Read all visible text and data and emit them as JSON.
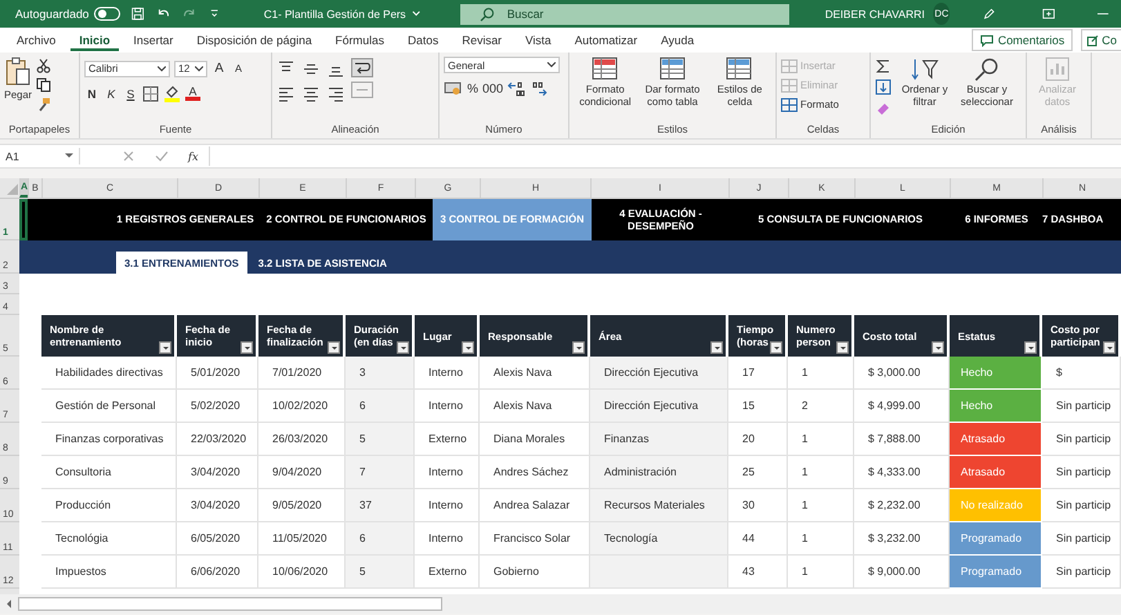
{
  "title_bar": {
    "autosave_label": "Autoguardado",
    "autosave_on": false,
    "file_name": "C1- Plantilla Gestión de Pers",
    "search_placeholder": "Buscar",
    "user_name": "DEIBER CHAVARRI",
    "user_initials": "DC"
  },
  "menu": {
    "tabs": [
      {
        "label": "Archivo",
        "selected": false
      },
      {
        "label": "Inicio",
        "selected": true
      },
      {
        "label": "Insertar",
        "selected": false
      },
      {
        "label": "Disposición de página",
        "selected": false
      },
      {
        "label": "Fórmulas",
        "selected": false
      },
      {
        "label": "Datos",
        "selected": false
      },
      {
        "label": "Revisar",
        "selected": false
      },
      {
        "label": "Vista",
        "selected": false
      },
      {
        "label": "Automatizar",
        "selected": false
      },
      {
        "label": "Ayuda",
        "selected": false
      }
    ],
    "comments_label": "Comentarios",
    "share_label": "Co"
  },
  "ribbon": {
    "groups": [
      {
        "kind": "clipboard",
        "label": "Portapapeles",
        "items": [
          {
            "label": "Pegar"
          }
        ]
      },
      {
        "kind": "font",
        "label": "Fuente",
        "font_name": "Calibri",
        "font_size": "12",
        "items": [
          {
            "kind": "grow",
            "label": "A"
          },
          {
            "kind": "shrink",
            "label": "A"
          },
          {
            "kind": "bold",
            "label": "N"
          },
          {
            "kind": "italic",
            "label": "K"
          },
          {
            "kind": "underline",
            "label": "S"
          },
          {
            "kind": "font-color",
            "label": "A"
          }
        ]
      },
      {
        "kind": "alignment",
        "label": "Alineación"
      },
      {
        "kind": "number",
        "label": "Número",
        "format": "General",
        "items": [
          {
            "label": "%"
          },
          {
            "label": "000"
          }
        ]
      },
      {
        "kind": "styles",
        "label": "Estilos",
        "items": [
          {
            "label": "Formato condicional"
          },
          {
            "label": "Dar formato como tabla"
          },
          {
            "label": "Estilos de celda"
          }
        ]
      },
      {
        "kind": "cells",
        "label": "Celdas",
        "items": [
          {
            "label": "Insertar",
            "disabled": true
          },
          {
            "label": "Eliminar",
            "disabled": true
          },
          {
            "label": "Formato",
            "disabled": false
          }
        ]
      },
      {
        "kind": "editing",
        "label": "Edición",
        "items": [
          {
            "label": "Ordenar y filtrar"
          },
          {
            "label": "Buscar y seleccionar"
          }
        ]
      },
      {
        "kind": "analysis",
        "label": "Análisis",
        "items": [
          {
            "label": "Analizar datos",
            "disabled": true
          }
        ]
      }
    ]
  },
  "formula_bar": {
    "name_box": "A1",
    "function_label": "fx"
  },
  "sheet": {
    "columns": [
      {
        "label": "A",
        "selected": true
      },
      {
        "label": "B",
        "selected": false
      },
      {
        "label": "C",
        "selected": false
      },
      {
        "label": "D",
        "selected": false
      },
      {
        "label": "E",
        "selected": false
      },
      {
        "label": "F",
        "selected": false
      },
      {
        "label": "G",
        "selected": false
      },
      {
        "label": "H",
        "selected": false
      },
      {
        "label": "I",
        "selected": false
      },
      {
        "label": "J",
        "selected": false
      },
      {
        "label": "K",
        "selected": false
      },
      {
        "label": "L",
        "selected": false
      },
      {
        "label": "M",
        "selected": false
      },
      {
        "label": "N",
        "selected": false
      }
    ],
    "row_numbers": [
      {
        "label": "1",
        "selected": true
      },
      {
        "label": "2",
        "selected": false
      },
      {
        "label": "3",
        "selected": false
      },
      {
        "label": "4",
        "selected": false
      },
      {
        "label": "5",
        "selected": false
      },
      {
        "label": "6",
        "selected": false
      },
      {
        "label": "7",
        "selected": false
      },
      {
        "label": "8",
        "selected": false
      },
      {
        "label": "9",
        "selected": false
      },
      {
        "label": "10",
        "selected": false
      },
      {
        "label": "11",
        "selected": false
      },
      {
        "label": "12",
        "selected": false
      }
    ],
    "nav_tabs": [
      {
        "label": "1 REGISTROS GENERALES",
        "selected": false
      },
      {
        "label": "2 CONTROL DE FUNCIONARIOS",
        "selected": false
      },
      {
        "label": "3 CONTROL DE FORMACIÓN",
        "selected": true
      },
      {
        "label": "4 EVALUACIÓN - DESEMPEÑO",
        "selected": false
      },
      {
        "label": "5 CONSULTA DE FUNCIONARIOS",
        "selected": false
      },
      {
        "label": "6 INFORMES",
        "selected": false
      },
      {
        "label": "7 DASHBOA",
        "selected": false
      }
    ],
    "sub_tabs": [
      {
        "label": "3.1 ENTRENAMIENTOS",
        "selected": true
      },
      {
        "label": "3.2 LISTA DE ASISTENCIA",
        "selected": false
      }
    ],
    "table": {
      "headers": [
        "Nombre de entrenamiento",
        "Fecha de inicio",
        "Fecha de finalización",
        "Duración (en días",
        "Lugar",
        "Responsable",
        "Área",
        "Tiempo (horas",
        "Numero person",
        "Costo total",
        "Estatus",
        "Costo por participan"
      ],
      "rows": [
        {
          "name": "Habilidades directivas",
          "start": "5/01/2020",
          "end": "7/01/2020",
          "duration": "3",
          "place": "Interno",
          "manager": "Alexis Nava",
          "area": "Dirección Ejecutiva",
          "hours": "17",
          "people": "1",
          "cost": "$ 3,000.00",
          "status": {
            "label": "Hecho",
            "color": "#5bb042"
          },
          "per_participant": "$"
        },
        {
          "name": "Gestión de Personal",
          "start": "5/02/2020",
          "end": "10/02/2020",
          "duration": "6",
          "place": "Interno",
          "manager": "Alexis Nava",
          "area": "Dirección Ejecutiva",
          "hours": "15",
          "people": "2",
          "cost": "$ 4,999.00",
          "status": {
            "label": "Hecho",
            "color": "#5bb042"
          },
          "per_participant": "Sin particip"
        },
        {
          "name": "Finanzas corporativas",
          "start": "22/03/2020",
          "end": "26/03/2020",
          "duration": "5",
          "place": "Externo",
          "manager": "Diana Morales",
          "area": "Finanzas",
          "hours": "20",
          "people": "1",
          "cost": "$ 7,888.00",
          "status": {
            "label": "Atrasado",
            "color": "#ee4530"
          },
          "per_participant": "Sin particip"
        },
        {
          "name": "Consultoria",
          "start": "3/04/2020",
          "end": "9/04/2020",
          "duration": "7",
          "place": "Interno",
          "manager": "Andres Sáchez",
          "area": "Administración",
          "hours": "25",
          "people": "1",
          "cost": "$ 4,333.00",
          "status": {
            "label": "Atrasado",
            "color": "#ee4530"
          },
          "per_participant": "Sin particip"
        },
        {
          "name": "Producción",
          "start": "3/04/2020",
          "end": "9/05/2020",
          "duration": "37",
          "place": "Interno",
          "manager": "Andrea Salazar",
          "area": "Recursos Materiales",
          "hours": "30",
          "people": "1",
          "cost": "$ 2,232.00",
          "status": {
            "label": "No realizado",
            "color": "#ffc000"
          },
          "per_participant": "Sin particip"
        },
        {
          "name": "Tecnológia",
          "start": "6/05/2020",
          "end": "11/05/2020",
          "duration": "6",
          "place": "Interno",
          "manager": "Francisco Solar",
          "area": "Tecnología",
          "hours": "44",
          "people": "1",
          "cost": "$ 3,232.00",
          "status": {
            "label": "Programado",
            "color": "#6699cc"
          },
          "per_participant": "Sin particip"
        },
        {
          "name": "Impuestos",
          "start": "6/06/2020",
          "end": "10/06/2020",
          "duration": "5",
          "place": "Externo",
          "manager": "Gobierno",
          "hours": "43",
          "people": "1",
          "cost": "$ 9,000.00",
          "status": {
            "label": "Programado",
            "color": "#6699cc"
          },
          "per_participant": "Sin particip"
        }
      ]
    }
  }
}
